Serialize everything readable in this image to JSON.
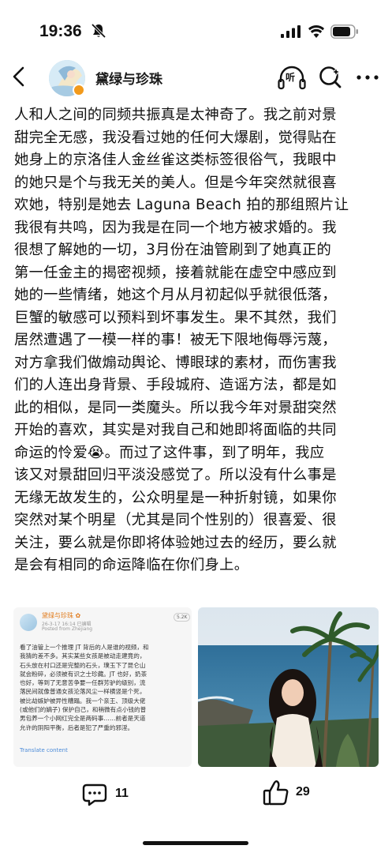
{
  "status_bar": {
    "time": "19:36",
    "icons": [
      "bell-off-icon",
      "signal-icon",
      "wifi-icon",
      "battery-icon"
    ]
  },
  "nav": {
    "back_icon": "chevron-left-icon",
    "username": "黛绿与珍珠",
    "listen_label": "听",
    "search_icon": "search-icon",
    "more_icon": "more-icon"
  },
  "post": {
    "lines": [
      "人和人之间的同频共振真是太神奇了。我之前对景",
      "甜完全无感，我没看过她的任何大爆剧，觉得贴在",
      "她身上的京洛佳人金丝雀这类标签很俗气，我眼中",
      "的她只是个与我无关的美人。但是今年突然就很喜",
      "欢她，特别是她去 Laguna Beach 拍的那组照片让",
      "我很有共鸣，因为我是在同一个地方被求婚的。我",
      "很想了解她的一切，3月份在油管刷到了她真正的",
      "第一任金主的揭密视频，接着就能在虚空中感应到",
      "她的一些情绪，她这个月从月初起似乎就很低落，",
      "巨蟹的敏感可以预料到坏事发生。果不其然，我们",
      "居然遭遇了一模一样的事！被无下限地侮辱污蔑，",
      "对方拿我们做煽动舆论、博眼球的素材，而伤害我",
      "们的人连出身背景、手段城府、造谣方法，都是如",
      "此的相似，是同一类魔头。所以我今年对景甜突然",
      "开始的喜欢，其实是对我自己和她即将面临的共同",
      "命运的怜爱😭。而过了这件事，到了明年，我应",
      "该又对景甜回归平淡没感觉了。所以没有什么事是",
      "无缘无故发生的，公众明星是一种折射镜，如果你",
      "突然对某个明星（尤其是同个性别的）很喜爱、很",
      "关注，要么就是你即将体验她过去的经历，要么就",
      "是会有相同的命运降临在你们身上。"
    ]
  },
  "embedded_screenshot": {
    "name": "黛绿与珍珠 ✿",
    "meta_line1": "26-3-17 16:14  已编辑",
    "meta_line2": "Posted from Zhejiang",
    "count": "5.2K",
    "body_lines": [
      "看了油管上一个推理 JT 背后的人是谁的视频，和",
      "我猜的差不多。其实某些女孩是被动走建竟的，",
      "石头放在村口还是完整的石头，璞玉下了昆仑山",
      "就会粉碎，必须被有识之士珍藏。JT 也好，奶茶",
      "也好，等到了无意苦争要一任群芳驴的级别，流",
      "落民间就像普通女孩沦落风尘一样横竖是个死，",
      "被比劫嫉妒被异性糟蹋。我一个亲王、顶级大佬",
      "(或他们的嫡子) 保护自己，和稍微有点小钱的普",
      "男包养一个小网红完全是两码事……前者是天道",
      "允许的阴阳平衡，后者是犯了严重的邪淫。"
    ],
    "link": "Translate content"
  },
  "actions": {
    "comment_count": "11",
    "like_count": "29"
  }
}
